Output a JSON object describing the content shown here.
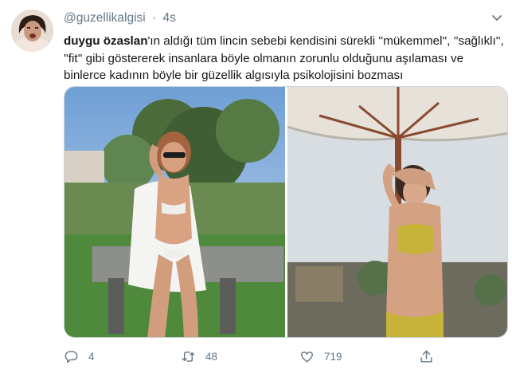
{
  "tweet": {
    "handle": "@guzellikalgisi",
    "separator": "·",
    "time": "4s",
    "mention": "duygu özaslan",
    "body": "'ın aldığı tüm lincin sebebi kendisini sürekli ''mükemmel'', ''sağlıklı'', ''fit'' gibi göstererek insanlara böyle olmanın zorunlu olduğunu aşılaması ve binlerce kadının böyle bir güzellik algısıyla psikolojisini bozması"
  },
  "actions": {
    "reply_count": "4",
    "retweet_count": "48",
    "like_count": "719"
  },
  "icons": {
    "avatar": "user-avatar",
    "more": "chevron-down-icon",
    "reply": "reply-icon",
    "retweet": "retweet-icon",
    "like": "heart-icon",
    "share": "share-icon"
  },
  "colors": {
    "secondary_text": "#657786",
    "primary_text": "#14171a",
    "border": "#ccd6dd"
  }
}
